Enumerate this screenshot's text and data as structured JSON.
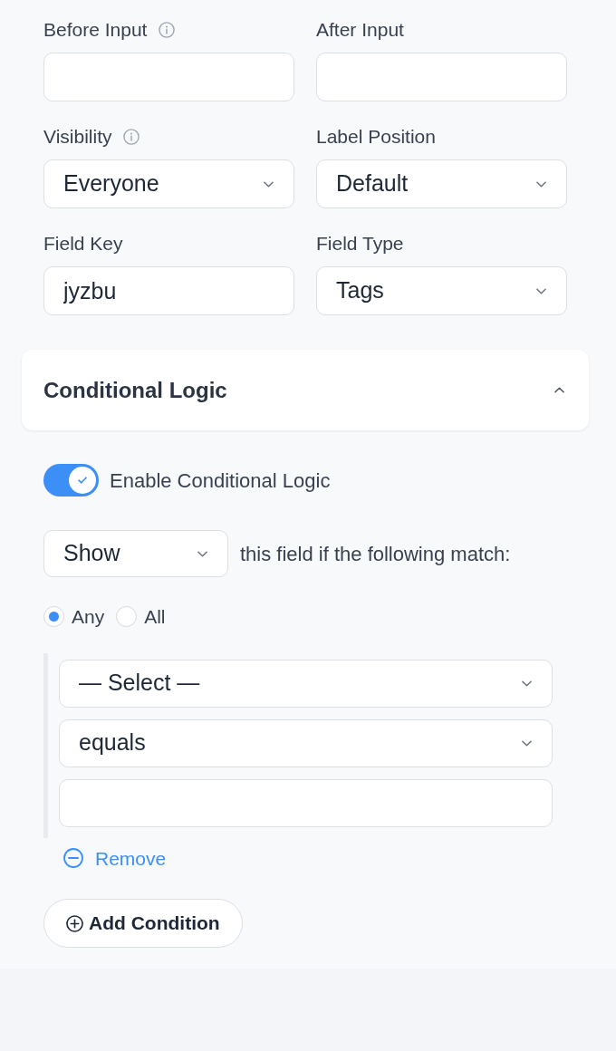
{
  "fields": [
    {
      "label": "Before Input",
      "info_icon": true,
      "kind": "input"
    },
    {
      "label": "After Input",
      "kind": "input"
    },
    {
      "label": "Visibility",
      "info_icon": true,
      "kind": "select",
      "value": "Everyone"
    },
    {
      "label": "Label Position",
      "kind": "select",
      "value": "Default"
    },
    {
      "label": "Field Key",
      "kind": "input",
      "value": "jyzbu"
    },
    {
      "label": "Field Type",
      "kind": "select",
      "value": "Tags"
    }
  ],
  "conditional_logic": {
    "title": "Conditional Logic",
    "expanded": true,
    "toggle": {
      "label": "Enable Conditional Logic",
      "on": true
    },
    "action_select": {
      "value": "Show"
    },
    "action_text": "this field if the following match:",
    "match_options": [
      {
        "label": "Any",
        "selected": true
      },
      {
        "label": "All",
        "selected": false
      }
    ],
    "conditions": [
      {
        "inputs": [
          {
            "kind": "select",
            "value": "— Select —"
          },
          {
            "kind": "select",
            "value": "equals"
          },
          {
            "kind": "input"
          }
        ],
        "remove_label": "Remove"
      }
    ],
    "add_button": "Add Condition"
  }
}
